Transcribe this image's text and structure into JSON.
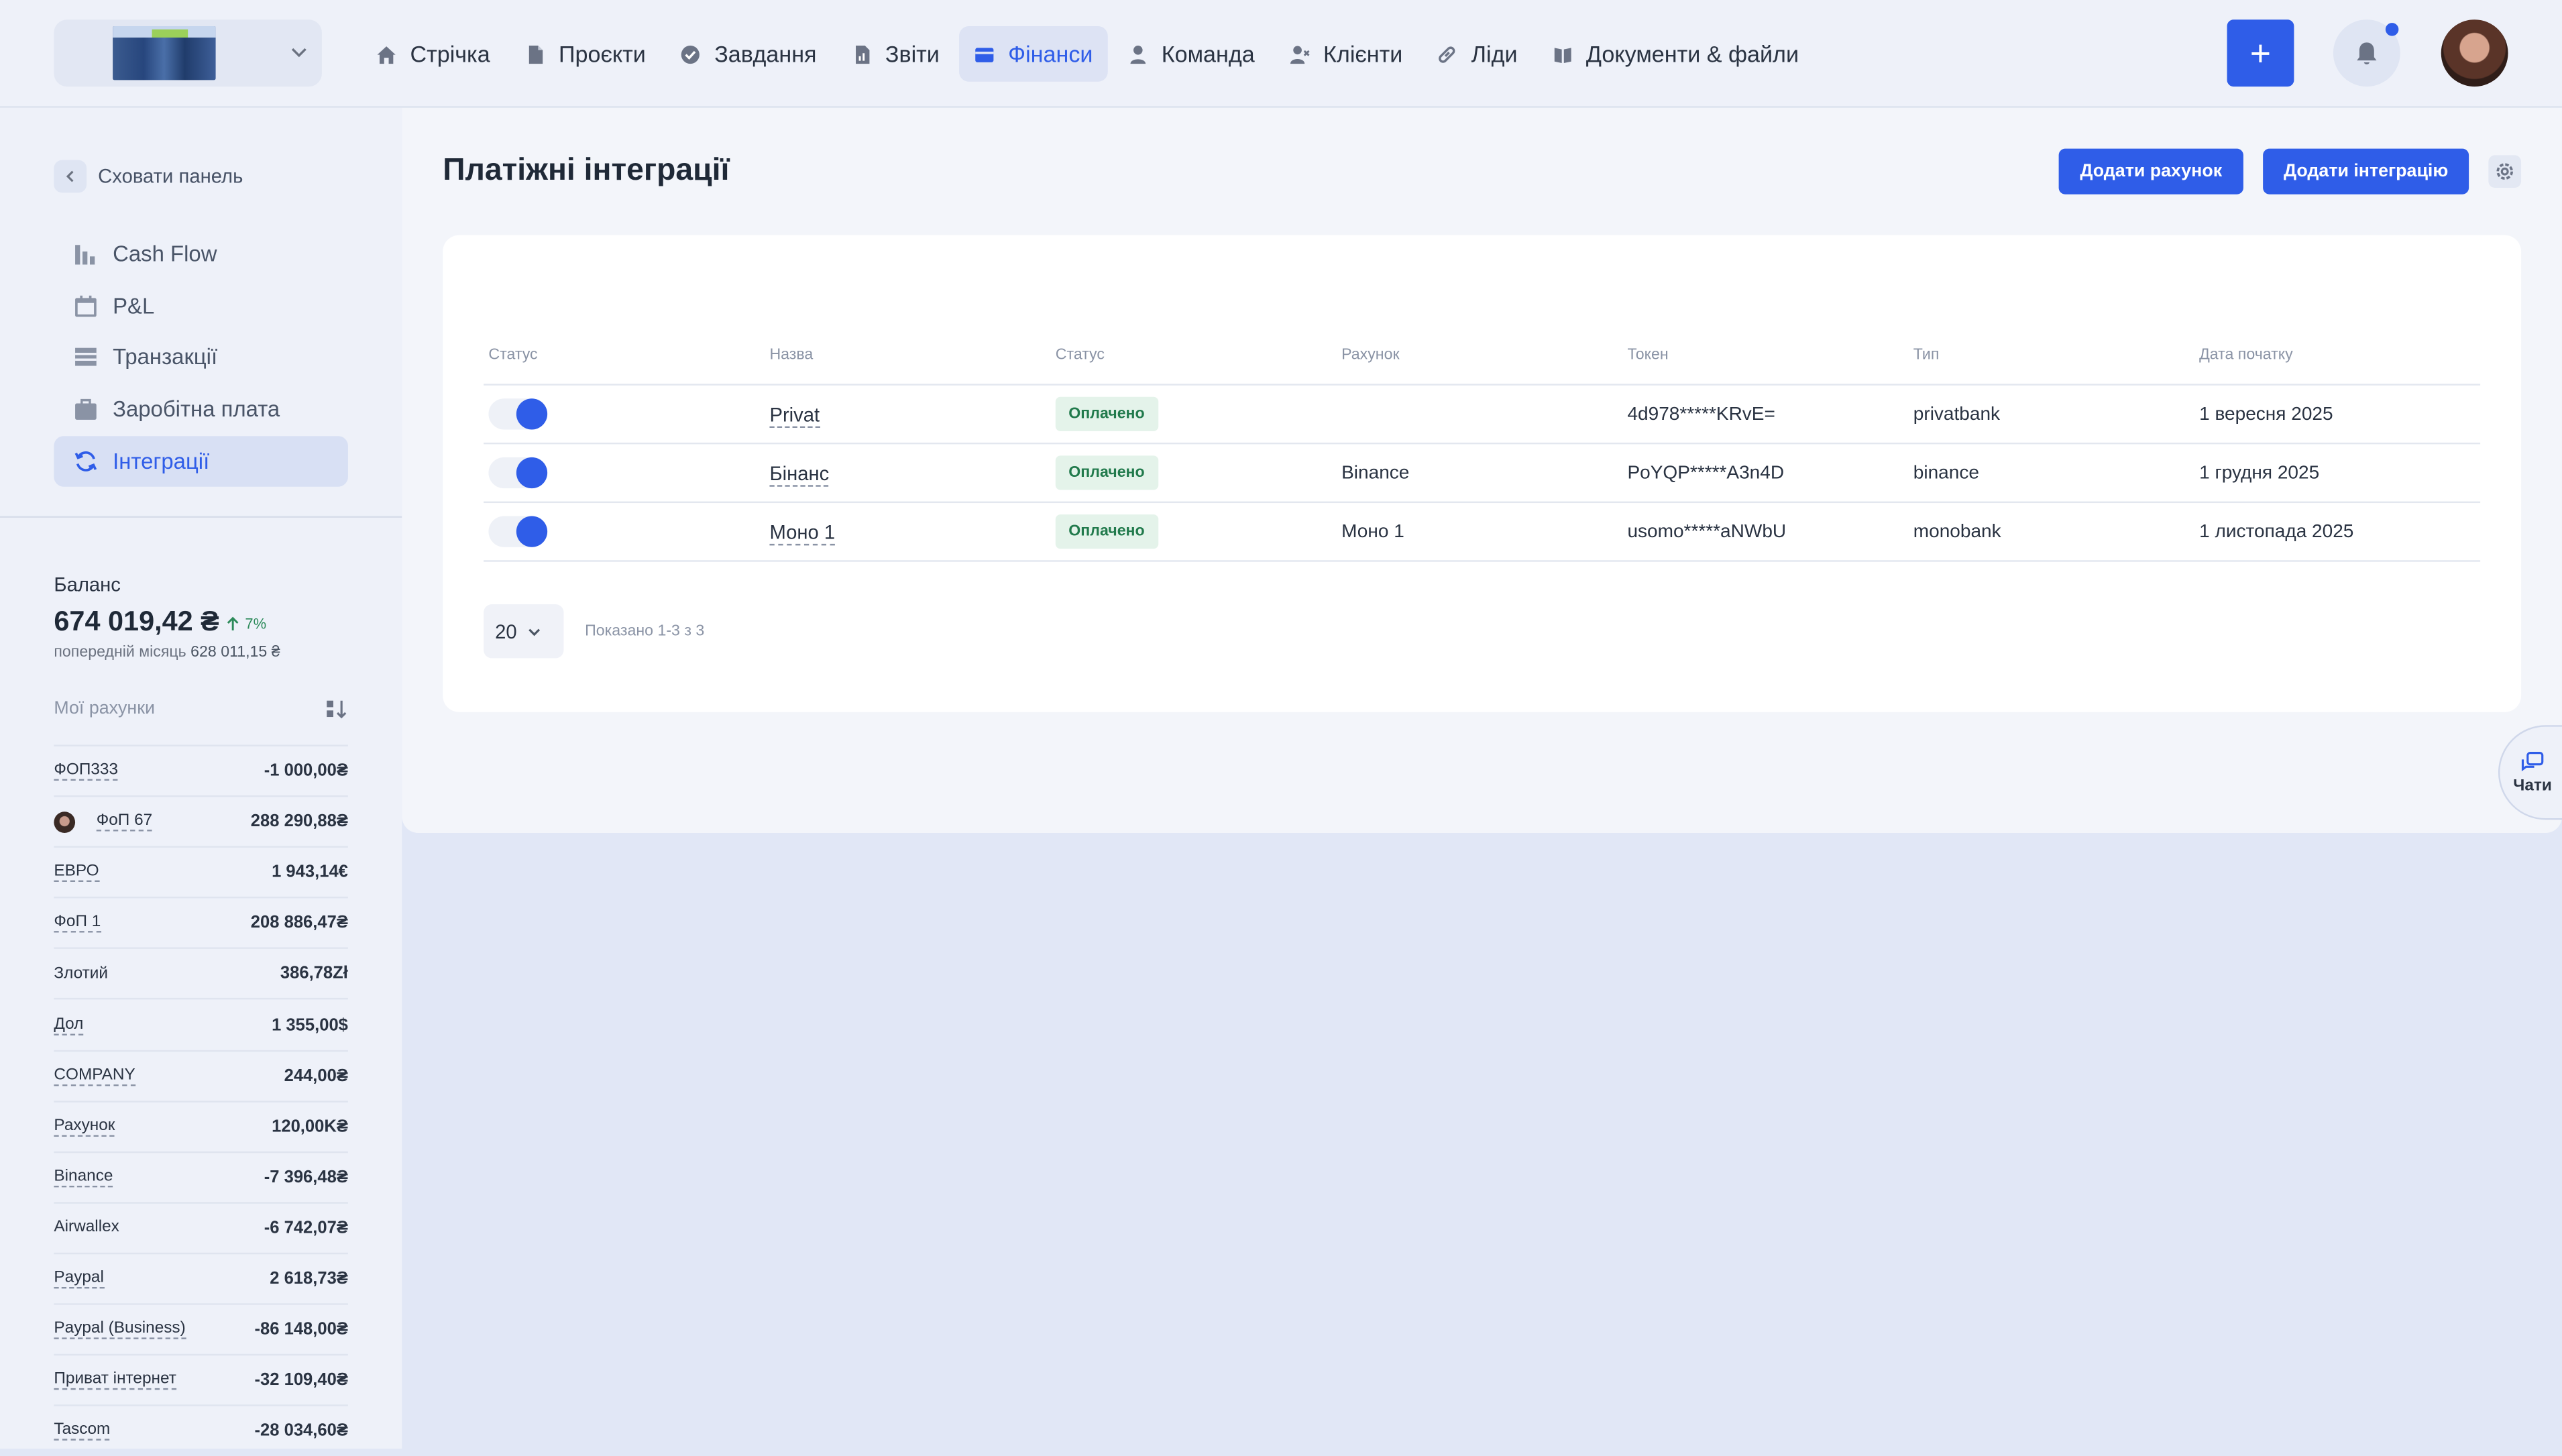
{
  "nav": {
    "items": [
      {
        "label": "Стрічка",
        "icon": "home-icon"
      },
      {
        "label": "Проєкти",
        "icon": "document-icon"
      },
      {
        "label": "Завдання",
        "icon": "check-circle-icon"
      },
      {
        "label": "Звіти",
        "icon": "report-icon"
      },
      {
        "label": "Фінанси",
        "icon": "wallet-icon"
      },
      {
        "label": "Команда",
        "icon": "user-icon"
      },
      {
        "label": "Клієнти",
        "icon": "users-icon"
      },
      {
        "label": "Ліди",
        "icon": "link-icon"
      },
      {
        "label": "Документи & файли",
        "icon": "book-icon"
      }
    ],
    "active": "Фінанси",
    "add_label": "+"
  },
  "sidebar": {
    "collapse_label": "Сховати панель",
    "menu": [
      {
        "label": "Cash Flow",
        "icon": "bar-chart-icon"
      },
      {
        "label": "P&L",
        "icon": "calendar-icon"
      },
      {
        "label": "Транзакції",
        "icon": "transactions-icon"
      },
      {
        "label": "Заробітна плата",
        "icon": "briefcase-icon"
      },
      {
        "label": "Інтеграції",
        "icon": "sync-icon"
      }
    ],
    "active": "Інтеграції",
    "balance": {
      "label": "Баланс",
      "value": "674 019,42 ₴",
      "change": "7%",
      "prev_label": "попередній місяць",
      "prev_value": "628 011,15 ₴"
    },
    "accounts_label": "Мої рахунки",
    "accounts": [
      {
        "name": "ФОП333",
        "amount": "-1 000,00₴"
      },
      {
        "name": "ФоП 67",
        "amount": "288 290,88₴",
        "avatar": true
      },
      {
        "name": "ЕВРО",
        "amount": "1 943,14€"
      },
      {
        "name": "ФоП 1",
        "amount": "208 886,47₴"
      },
      {
        "name": "Злотий",
        "amount": "386,78Zł"
      },
      {
        "name": "Дол",
        "amount": "1 355,00$"
      },
      {
        "name": "COMPANY",
        "amount": "244,00₴"
      },
      {
        "name": "Рахунок",
        "amount": "120,00K₴"
      },
      {
        "name": "Binance",
        "amount": "-7 396,48₴"
      },
      {
        "name": "Airwallex",
        "amount": "-6 742,07₴"
      },
      {
        "name": "Paypal",
        "amount": "2 618,73₴"
      },
      {
        "name": "Paypal (Business)",
        "amount": "-86 148,00₴"
      },
      {
        "name": "Приват інтернет",
        "amount": "-32 109,40₴"
      },
      {
        "name": "Tascom",
        "amount": "-28 034,60₴"
      }
    ]
  },
  "main": {
    "title": "Платіжні інтеграції",
    "add_account_label": "Додати рахунок",
    "add_integration_label": "Додати інтеграцію",
    "table": {
      "headers": [
        "Статус",
        "Назва",
        "Статус",
        "Рахунок",
        "Токен",
        "Тип",
        "Дата початку"
      ],
      "rows": [
        {
          "enabled": true,
          "name": "Privat",
          "status": "Оплачено",
          "account": "",
          "token": "4d978*****KRvE=",
          "type": "privatbank",
          "date": "1 вересня 2025"
        },
        {
          "enabled": true,
          "name": "Бінанс",
          "status": "Оплачено",
          "account": "Binance",
          "token": "PoYQP*****A3n4D",
          "type": "binance",
          "date": "1 грудня 2025"
        },
        {
          "enabled": true,
          "name": "Моно 1",
          "status": "Оплачено",
          "account": "Моно 1",
          "token": "usomo*****aNWbU",
          "type": "monobank",
          "date": "1 листопада 2025"
        }
      ]
    },
    "pagination": {
      "per_page": "20",
      "shown": "Показано 1-3 з 3"
    }
  },
  "chats_label": "Чати",
  "colors": {
    "accent": "#2f5de8",
    "success_bg": "#e4f3ea",
    "success_text": "#217a4c",
    "page_bg": "#e1e7f6"
  }
}
